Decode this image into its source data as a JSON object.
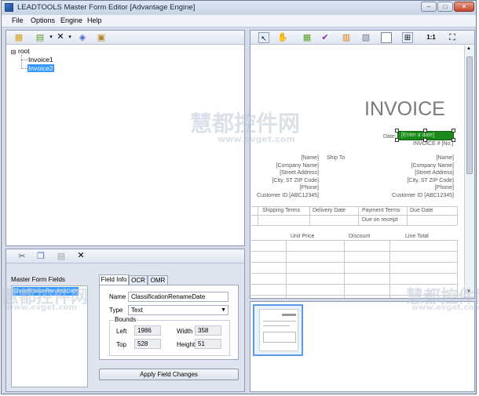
{
  "window": {
    "title": "LEADTOOLS Master Form Editor [Advantage Engine]"
  },
  "caption": {
    "minimize": "–",
    "maximize": "□",
    "close": "✕"
  },
  "menu": [
    "File",
    "Options",
    "Engine",
    "Help"
  ],
  "tree": {
    "root": "root",
    "items": [
      "Invoice1",
      "Invoice2"
    ],
    "selected": "Invoice2"
  },
  "fields_panel": {
    "title": "Master Form Fields",
    "items": [
      "ClassificationRenameDate"
    ]
  },
  "tabs": [
    "Field Info",
    "OCR",
    "OMR"
  ],
  "field_info": {
    "name_label": "Name",
    "name_value": "ClassificationRenameDate",
    "type_label": "Type",
    "type_value": "Text",
    "bounds_label": "Bounds",
    "left_label": "Left",
    "left_value": "1986",
    "width_label": "Width",
    "width_value": "358",
    "top_label": "Top",
    "top_value": "528",
    "height_label": "Height",
    "height_value": "51",
    "apply_label": "Apply Field Changes"
  },
  "viewer_toolbar": {
    "zoom_label": "1:1"
  },
  "invoice": {
    "title": "INVOICE",
    "date_label": "Date:",
    "date_value": "[Enter a date]",
    "invoice_no": "INVOICE # [No.]",
    "ship_to": "Ship To",
    "left_block": [
      "[Name]",
      "[Company Name]",
      "[Street Address]",
      "[City, ST ZIP Code]",
      "[Phone]",
      "Customer ID [ABC12345]"
    ],
    "right_block": [
      "[Name]",
      "[Company Name]",
      "[Street Address]",
      "[City, ST ZIP Code]",
      "[Phone]",
      "Customer ID [ABC12345]"
    ],
    "terms_headers": [
      "Shipping Terms",
      "Delivery Date",
      "Payment Terms",
      "Due Date"
    ],
    "due_on_receipt": "Due on receipt",
    "line_headers": [
      "Unit Price",
      "Discount",
      "Line Total"
    ]
  },
  "watermark": {
    "cn": "慧都控件网",
    "url": "www.evget.com"
  },
  "colors": {
    "selection": "#3399ff",
    "field_highlight": "#1a8a1a",
    "chrome": "#d6dbe9"
  }
}
